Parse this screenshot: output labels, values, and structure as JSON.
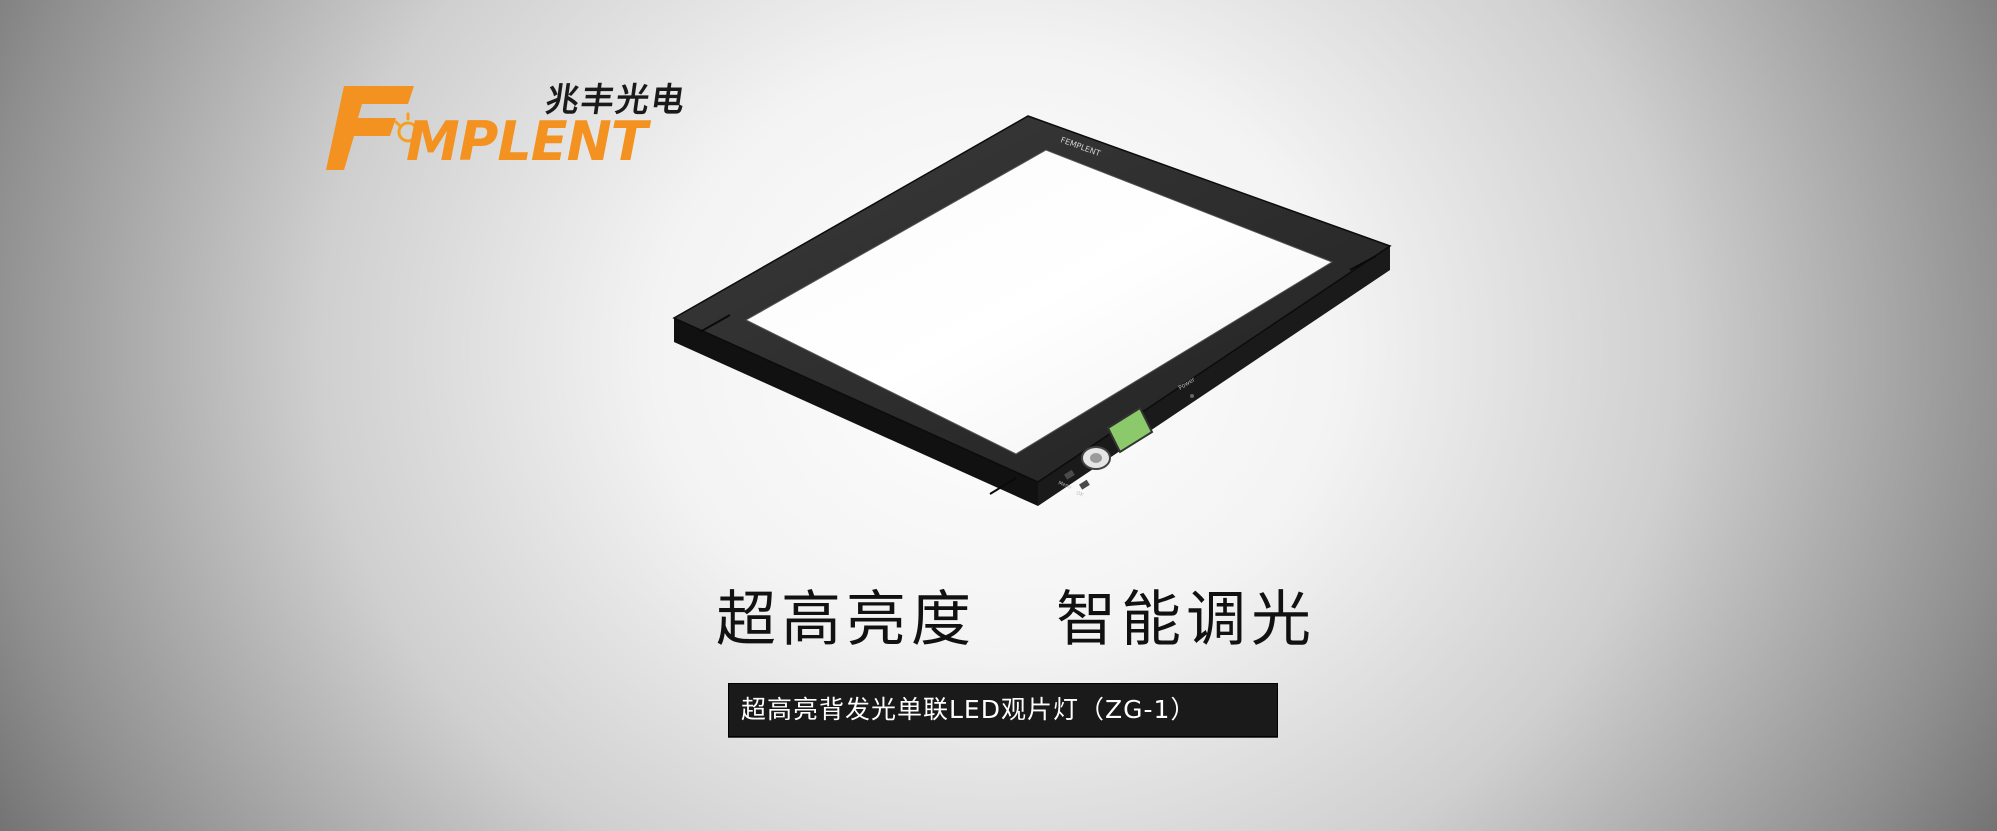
{
  "brand": {
    "chinese_name": "兆丰光电",
    "logo_wordmark": "FEMPLENT",
    "logo_letter_suffix": "MPLENT",
    "orange": "#f39220",
    "orange_accent": "#f5a020"
  },
  "device": {
    "frame_brand": "FEMPLENT",
    "power_label": "Power",
    "menu_label": "Menu",
    "ok_label": "OK",
    "frame_color": "#1f1f1f",
    "panel_color": "#ffffff",
    "lcd_color": "#8bc96a"
  },
  "headline": {
    "left": "超高亮度",
    "right": "智能调光"
  },
  "caption": {
    "text": "超高亮背发光单联LED观片灯（ZG-1）"
  }
}
